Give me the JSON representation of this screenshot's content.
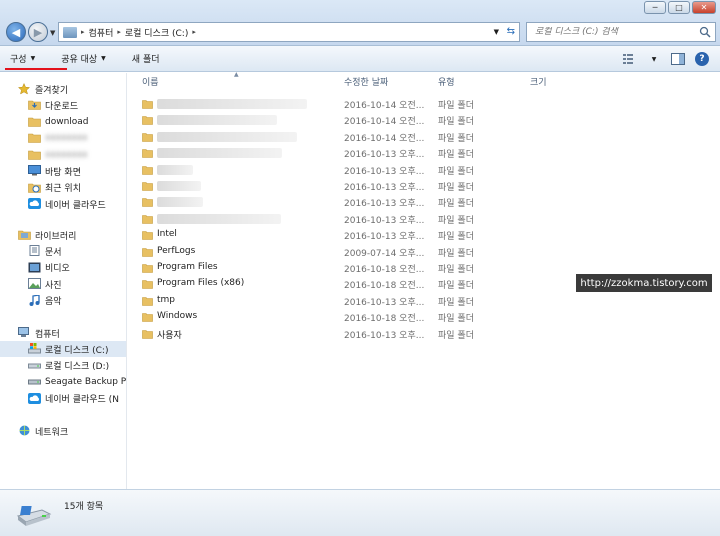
{
  "window": {
    "minimize_glyph": "─",
    "maximize_glyph": "□",
    "close_glyph": "✕"
  },
  "address": {
    "segments": [
      "컴퓨터",
      "로컬 디스크 (C:)"
    ],
    "separator": "▸"
  },
  "search": {
    "placeholder": "로컬 디스크 (C:) 검색"
  },
  "toolbar": {
    "organize_label": "구성",
    "share_label": "공유 대상",
    "new_folder_label": "새 폴더"
  },
  "navpane": {
    "favorites_label": "즐겨찾기",
    "favorites": [
      {
        "label": "다운로드",
        "icon": "downloads-folder-icon",
        "blurred": false
      },
      {
        "label": "download",
        "icon": "folder-icon",
        "blurred": false
      },
      {
        "label": "xxxxxxxx",
        "icon": "folder-icon",
        "blurred": true
      },
      {
        "label": "xxxxxxxx",
        "icon": "folder-icon",
        "blurred": true
      },
      {
        "label": "바탕 화면",
        "icon": "desktop-icon",
        "blurred": false
      },
      {
        "label": "최근 위치",
        "icon": "recent-places-icon",
        "blurred": false
      },
      {
        "label": "네이버 클라우드",
        "icon": "cloud-icon",
        "blurred": false
      }
    ],
    "libraries_label": "라이브러리",
    "libraries": [
      {
        "label": "문서",
        "icon": "documents-icon"
      },
      {
        "label": "비디오",
        "icon": "videos-icon"
      },
      {
        "label": "사진",
        "icon": "pictures-icon"
      },
      {
        "label": "음악",
        "icon": "music-icon"
      }
    ],
    "computer_label": "컴퓨터",
    "computer": [
      {
        "label": "로컬 디스크 (C:)",
        "icon": "windows-drive-icon",
        "selected": true
      },
      {
        "label": "로컬 디스크 (D:)",
        "icon": "drive-icon",
        "selected": false
      },
      {
        "label": "Seagate Backup Plu",
        "icon": "external-drive-icon",
        "selected": false
      },
      {
        "label": "네이버 클라우드 (N",
        "icon": "cloud-icon",
        "selected": false
      }
    ],
    "network_label": "네트워크"
  },
  "columns": {
    "name": "이름",
    "modified": "수정한 날짜",
    "type": "유형",
    "size": "크기"
  },
  "files": [
    {
      "name": "xxxxxxxxxxxxxxxxxxxxxxxxxxx",
      "date": "2016-10-14 오전...",
      "type": "파일 폴더",
      "blurred": true,
      "w": 150
    },
    {
      "name": "xxxxxxxxxxxxxxxxxxxxxx",
      "date": "2016-10-14 오전...",
      "type": "파일 폴더",
      "blurred": true,
      "w": 120
    },
    {
      "name": "xxxxxxxxxxxxxxxxxxxxxxxxxx",
      "date": "2016-10-14 오전...",
      "type": "파일 폴더",
      "blurred": true,
      "w": 140
    },
    {
      "name": "xxxxxxxxxxxxxxxxxxxxxxx",
      "date": "2016-10-13 오후...",
      "type": "파일 폴더",
      "blurred": true,
      "w": 125
    },
    {
      "name": "xxxxxxx",
      "date": "2016-10-13 오후...",
      "type": "파일 폴더",
      "blurred": true,
      "w": 36
    },
    {
      "name": "xxxxxxxx",
      "date": "2016-10-13 오후...",
      "type": "파일 폴더",
      "blurred": true,
      "w": 44
    },
    {
      "name": "xxxxxxxxx",
      "date": "2016-10-13 오후...",
      "type": "파일 폴더",
      "blurred": true,
      "w": 46
    },
    {
      "name": "xxxxxxxxxxxxxxxxxxxxxxx",
      "date": "2016-10-13 오후...",
      "type": "파일 폴더",
      "blurred": true,
      "w": 124
    },
    {
      "name": "Intel",
      "date": "2016-10-13 오후...",
      "type": "파일 폴더",
      "blurred": false
    },
    {
      "name": "PerfLogs",
      "date": "2009-07-14 오후...",
      "type": "파일 폴더",
      "blurred": false
    },
    {
      "name": "Program Files",
      "date": "2016-10-18 오전...",
      "type": "파일 폴더",
      "blurred": false
    },
    {
      "name": "Program Files (x86)",
      "date": "2016-10-18 오전...",
      "type": "파일 폴더",
      "blurred": false
    },
    {
      "name": "tmp",
      "date": "2016-10-13 오후...",
      "type": "파일 폴더",
      "blurred": false
    },
    {
      "name": "Windows",
      "date": "2016-10-18 오전...",
      "type": "파일 폴더",
      "blurred": false
    },
    {
      "name": "사용자",
      "date": "2016-10-13 오후...",
      "type": "파일 폴더",
      "blurred": false
    }
  ],
  "watermark": "http://zzokma.tistory.com",
  "details": {
    "item_count": "15개 항목"
  },
  "colors": {
    "folder": "#e8c062",
    "accent_red": "#e3121b",
    "selected_bg": "#dde8f4"
  }
}
